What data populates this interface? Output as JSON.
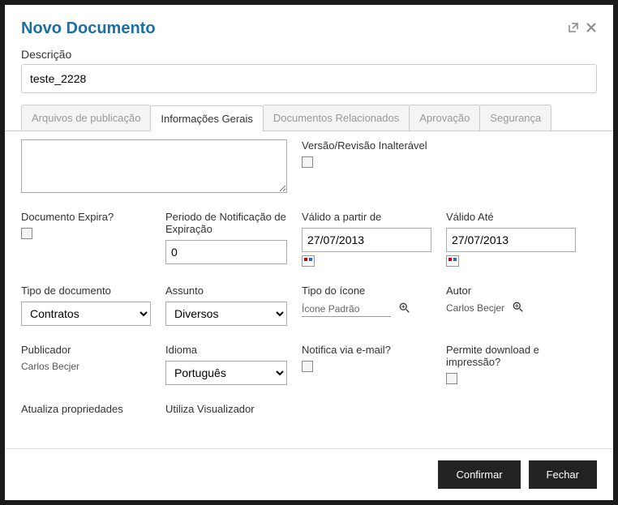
{
  "header": {
    "title": "Novo Documento"
  },
  "description": {
    "label": "Descrição",
    "value": "teste_2228"
  },
  "tabs": [
    {
      "label": "Arquivos de publicação"
    },
    {
      "label": "Informações Gerais"
    },
    {
      "label": "Documentos Relacionados"
    },
    {
      "label": "Aprovação"
    },
    {
      "label": "Segurança"
    }
  ],
  "form": {
    "versao_label": "Versão/Revisão Inalterável",
    "expira_label": "Documento Expira?",
    "periodo_label": "Periodo de Notificação de Expiração",
    "periodo_value": "0",
    "valido_de_label": "Válido a partir de",
    "valido_de_value": "27/07/2013",
    "valido_ate_label": "Válido Até",
    "valido_ate_value": "27/07/2013",
    "tipo_doc_label": "Tipo de documento",
    "tipo_doc_value": "Contratos",
    "assunto_label": "Assunto",
    "assunto_value": "Diversos",
    "tipo_icone_label": "Tipo do ícone",
    "tipo_icone_value": "Ícone Padrão",
    "autor_label": "Autor",
    "autor_value": "Carlos Becjer",
    "publicador_label": "Publicador",
    "publicador_value": "Carlos Becjer",
    "idioma_label": "Idioma",
    "idioma_value": "Português",
    "notifica_label": "Notifica via e-mail?",
    "permite_download_label": "Permite download e impressão?",
    "atualiza_label": "Atualiza propriedades",
    "utiliza_label": "Utiliza Visualizador"
  },
  "footer": {
    "confirm": "Confirmar",
    "close": "Fechar"
  }
}
